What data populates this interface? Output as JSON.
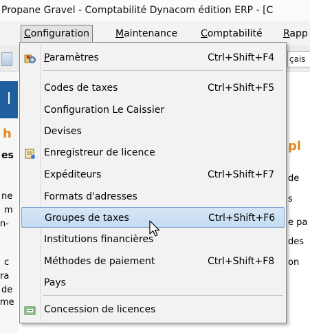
{
  "window": {
    "title": "Propane Gravel - Comptabilité Dynacom édition ERP - [C"
  },
  "menubar": [
    {
      "label": "Configuration",
      "underline": "C",
      "rest": "onfiguration",
      "active": true
    },
    {
      "label": "Maintenance",
      "underline": "M",
      "rest": "aintenance",
      "active": false
    },
    {
      "label": "Comptabilité",
      "underline": "C",
      "rest": "omptabilité",
      "active": false
    },
    {
      "label": "Rapp",
      "underline": "R",
      "rest": "app",
      "active": false
    }
  ],
  "toolbar": {
    "field_text": "çais"
  },
  "background": {
    "fragments": [
      "l",
      "h",
      "es",
      "pl",
      "de",
      "s",
      "e pa",
      "des",
      "on",
      "ne",
      "m",
      "n-",
      "c",
      "ra",
      "de",
      "me"
    ]
  },
  "dropdown": {
    "items": [
      {
        "label": "Paramètres",
        "underline": "P",
        "rest": "aramètres",
        "shortcut": "Ctrl+Shift+F4",
        "icon": "settings-gears-icon"
      },
      {
        "label": "Codes de taxes",
        "shortcut": "Ctrl+Shift+F5"
      },
      {
        "label": "Configuration Le Caissier",
        "shortcut": ""
      },
      {
        "label": "Devises",
        "shortcut": ""
      },
      {
        "label": "Enregistreur de licence",
        "shortcut": "",
        "icon": "license-register-icon"
      },
      {
        "label": "Expéditeurs",
        "shortcut": "Ctrl+Shift+F7"
      },
      {
        "label": "Formats d'adresses",
        "shortcut": ""
      },
      {
        "label": "Groupes de taxes",
        "shortcut": "Ctrl+Shift+F6",
        "highlighted": true
      },
      {
        "label": "Institutions financières",
        "shortcut": ""
      },
      {
        "label": "Méthodes de paiement",
        "shortcut": "Ctrl+Shift+F8"
      },
      {
        "label": "Pays",
        "shortcut": ""
      },
      {
        "label": "Concession de licences",
        "shortcut": "",
        "icon": "license-grant-icon"
      }
    ]
  },
  "colors": {
    "highlight": "#c9def4",
    "highlight_border": "#7da2ce",
    "accent_blue": "#1f5fa0",
    "orange": "#e08a1e"
  }
}
